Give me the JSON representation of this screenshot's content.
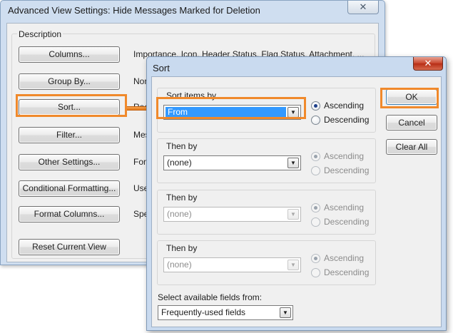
{
  "advanced_view": {
    "title": "Advanced View Settings: Hide Messages Marked for Deletion",
    "close_glyph": "✕",
    "group_label": "Description",
    "rows": [
      {
        "button": "Columns...",
        "description": "Importance, Icon, Header Status, Flag Status, Attachment, ..."
      },
      {
        "button": "Group By...",
        "description": "None"
      },
      {
        "button": "Sort...",
        "description": "Received (descending)"
      },
      {
        "button": "Filter...",
        "description": "Messages: Off"
      },
      {
        "button": "Other Settings...",
        "description": "Fonts and other Table View settings"
      },
      {
        "button": "Conditional Formatting...",
        "description": "User defined fonts on each message"
      },
      {
        "button": "Format Columns...",
        "description": "Specify the display formats for each field"
      }
    ],
    "reset_button": "Reset Current View"
  },
  "sort": {
    "title": "Sort",
    "close_glyph": "✕",
    "ok_label": "OK",
    "cancel_label": "Cancel",
    "clear_all_label": "Clear All",
    "dropdown_glyph": "▼",
    "groups": [
      {
        "label": "Sort items by",
        "value": "From",
        "ascending": "Ascending",
        "descending": "Descending"
      },
      {
        "label": "Then by",
        "value": "(none)",
        "ascending": "Ascending",
        "descending": "Descending"
      },
      {
        "label": "Then by",
        "value": "(none)",
        "ascending": "Ascending",
        "descending": "Descending"
      },
      {
        "label": "Then by",
        "value": "(none)",
        "ascending": "Ascending",
        "descending": "Descending"
      }
    ],
    "fields_from_label": "Select available fields from:",
    "fields_from_value": "Frequently-used fields"
  },
  "colors": {
    "highlight": "#f0892b",
    "selection": "#3399ff",
    "close_red": "#c7432a"
  }
}
